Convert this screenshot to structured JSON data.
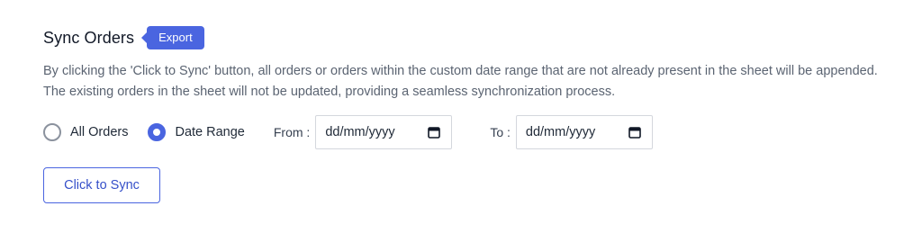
{
  "section": {
    "title": "Sync Orders",
    "badge": "Export",
    "description": "By clicking the 'Click to Sync' button, all orders or orders within the custom date range that are not already present in the sheet will be appended. The existing orders in the sheet will not be updated, providing a seamless synchronization process."
  },
  "sync_mode": {
    "options": [
      {
        "label": "All Orders",
        "selected": false
      },
      {
        "label": "Date Range",
        "selected": true
      }
    ]
  },
  "date_range": {
    "from_label": "From :",
    "from_value": "dd/mm/yyyy",
    "to_label": "To :",
    "to_value": "dd/mm/yyyy"
  },
  "actions": {
    "sync_button": "Click to Sync"
  },
  "colors": {
    "accent": "#4a65e0",
    "text_muted": "#5b6472"
  },
  "icons": {
    "date_picker": "calendar-icon"
  }
}
